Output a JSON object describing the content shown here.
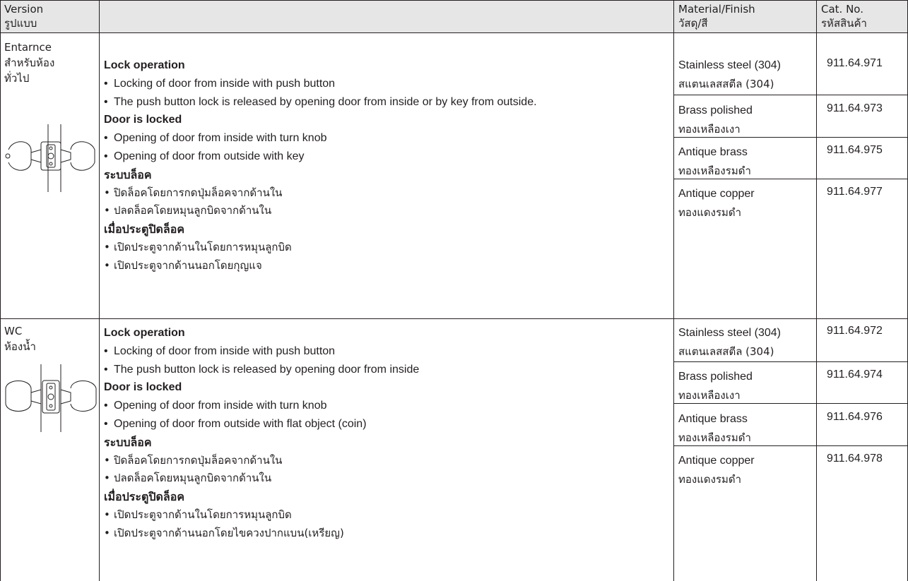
{
  "header": {
    "version": [
      "Version",
      "รูปแบบ"
    ],
    "material": [
      "Material/Finish",
      "วัสดุ/สี"
    ],
    "catno": [
      "Cat. No.",
      "รหัสสินค้า"
    ]
  },
  "rows": [
    {
      "version": [
        "Entarnce",
        "สำหรับห้อง",
        "ทั่วไป"
      ],
      "lock_operation_title": "Lock operation",
      "lock_operation": [
        "Locking of door from inside with push button",
        "The push button lock is released by opening door from inside or by key from outside."
      ],
      "door_locked_title": "Door is locked",
      "door_locked": [
        "Opening of door from inside with turn knob",
        "Opening of door from outside with key"
      ],
      "th_lock_title": "ระบบล็อค",
      "th_lock": [
        "ปิดล็อคโดยการกดปุ่มล็อคจากด้านใน",
        "ปลดล็อคโดยหมุนลูกบิดจากด้านใน"
      ],
      "th_locked_title": "เมื่อประตูปิดล็อค",
      "th_locked": [
        "เปิดประตูจากด้านในโดยการหมุนลูกบิด",
        "เปิดประตูจากด้านนอกโดยกุญแจ"
      ],
      "variants": [
        {
          "material": "Stainless steel (304)",
          "material_th": "สแตนเลสสตีล (304)",
          "cat": "911.64.971"
        },
        {
          "material": "Brass polished",
          "material_th": "ทองเหลืองเงา",
          "cat": "911.64.973"
        },
        {
          "material": "Antique brass",
          "material_th": "ทองเหลืองรมดำ",
          "cat": "911.64.975"
        },
        {
          "material": "Antique copper",
          "material_th": "ทองแดงรมดำ",
          "cat": "911.64.977"
        }
      ]
    },
    {
      "version": [
        "WC",
        "ห้องน้ำ"
      ],
      "lock_operation_title": "Lock operation",
      "lock_operation": [
        "Locking of door from inside with push button",
        "The push button lock is released by opening door from inside"
      ],
      "door_locked_title": "Door is locked",
      "door_locked": [
        "Opening of door from inside with turn knob",
        "Opening of door from outside with flat object (coin)"
      ],
      "th_lock_title": "ระบบล็อค",
      "th_lock": [
        "ปิดล็อคโดยการกดปุ่มล็อคจากด้านใน",
        "ปลดล็อคโดยหมุนลูกบิดจากด้านใน"
      ],
      "th_locked_title": "เมื่อประตูปิดล็อค",
      "th_locked": [
        "เปิดประตูจากด้านในโดยการหมุนลูกบิด",
        "เปิดประตูจากด้านนอกโดยไขควงปากแบน(เหรียญ)"
      ],
      "variants": [
        {
          "material": "Stainless steel (304)",
          "material_th": "สแตนเลสสตีล (304)",
          "cat": "911.64.972"
        },
        {
          "material": "Brass polished",
          "material_th": "ทองเหลืองเงา",
          "cat": "911.64.974"
        },
        {
          "material": "Antique brass",
          "material_th": "ทองเหลืองรมดำ",
          "cat": "911.64.976"
        },
        {
          "material": "Antique copper",
          "material_th": "ทองแดงรมดำ",
          "cat": "911.64.978"
        }
      ]
    }
  ],
  "icons": [
    "entrance-lockset-icon",
    "wc-lockset-icon"
  ],
  "colors": {
    "header_bg": "#e6e6e6",
    "text": "#231f20",
    "rule": "#231f20"
  }
}
